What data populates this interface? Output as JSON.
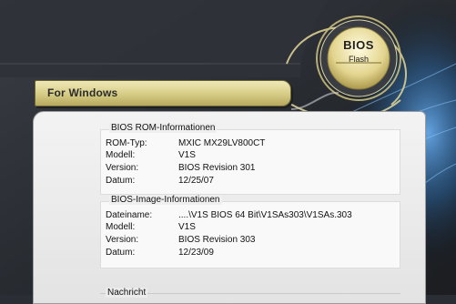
{
  "header": {
    "banner_label": "For Windows"
  },
  "bios_button": {
    "title": "BIOS",
    "subtitle": "Flash"
  },
  "rom_info": {
    "title": "BIOS ROM-Informationen",
    "rows": [
      {
        "key": "ROM-Typ:",
        "value": "MXIC MX29LV800CT"
      },
      {
        "key": "Modell:",
        "value": "V1S"
      },
      {
        "key": "Version:",
        "value": "BIOS Revision 301"
      },
      {
        "key": "Datum:",
        "value": "12/25/07"
      }
    ]
  },
  "image_info": {
    "title": "BIOS-Image-Informationen",
    "rows": [
      {
        "key": "Dateiname:",
        "value": "....\\V1S BIOS 64 Bit\\V1SAs303\\V1SAs.303"
      },
      {
        "key": "Modell:",
        "value": "V1S"
      },
      {
        "key": "Version:",
        "value": "BIOS Revision 303"
      },
      {
        "key": "Datum:",
        "value": "12/23/09"
      }
    ]
  },
  "message": {
    "title": "Nachricht"
  },
  "colors": {
    "banner": "#d6cb85",
    "background": "#2a2d33",
    "accent_blue": "#3d8fd1"
  }
}
